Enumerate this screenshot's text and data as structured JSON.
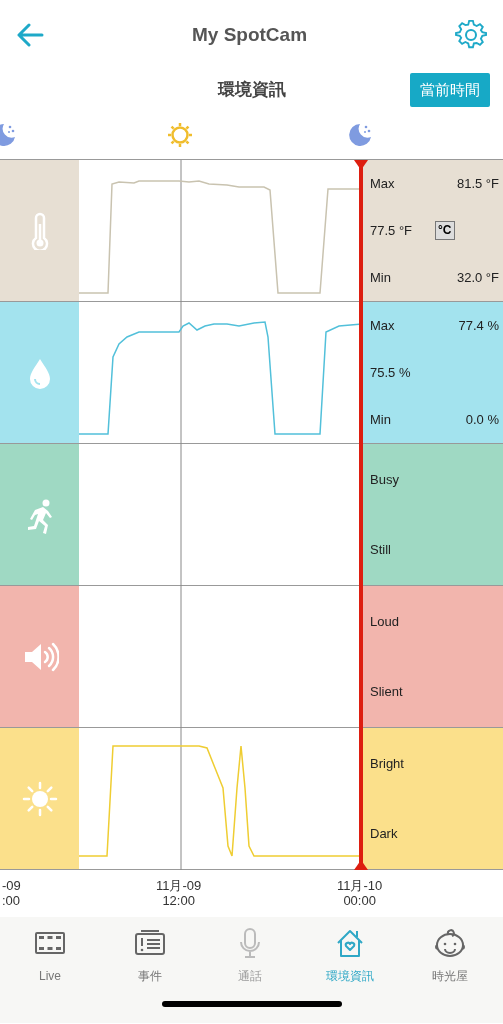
{
  "header": {
    "title": "My SpotCam"
  },
  "subheader": {
    "title": "環境資訊",
    "button": "當前時間"
  },
  "daylight": [
    {
      "kind": "night"
    },
    {
      "kind": "day"
    },
    {
      "kind": "night"
    }
  ],
  "sensors": [
    {
      "kind": "temperature",
      "color": "#e7dfd3",
      "max_label": "Max",
      "max": "81.5 °F",
      "current": "77.5 °F",
      "unit_button": "°C",
      "min_label": "Min",
      "min": "32.0 °F"
    },
    {
      "kind": "humidity",
      "color": "#a3e3ee",
      "max_label": "Max",
      "max": "77.4 %",
      "current": "75.5 %",
      "min_label": "Min",
      "min": "0.0 %"
    },
    {
      "kind": "motion",
      "color": "#9fd9c3",
      "high": "Busy",
      "low": "Still"
    },
    {
      "kind": "sound",
      "color": "#f2b5ad",
      "high": "Loud",
      "low": "Slient"
    },
    {
      "kind": "light",
      "color": "#fbe08b",
      "high": "Bright",
      "low": "Dark"
    }
  ],
  "x_axis": [
    {
      "date": "-09",
      "time": ":00"
    },
    {
      "date": "11月-09",
      "time": "12:00"
    },
    {
      "date": "11月-10",
      "time": "00:00"
    }
  ],
  "tabs": [
    {
      "kind": "live",
      "label": "Live",
      "selected": false,
      "disabled": false
    },
    {
      "kind": "events",
      "label": "事件",
      "selected": false,
      "disabled": false
    },
    {
      "kind": "talk",
      "label": "通話",
      "selected": false,
      "disabled": true
    },
    {
      "kind": "environment",
      "label": "環境資訊",
      "selected": true,
      "disabled": false
    },
    {
      "kind": "timelapse",
      "label": "時光屋",
      "selected": false,
      "disabled": false
    }
  ]
}
